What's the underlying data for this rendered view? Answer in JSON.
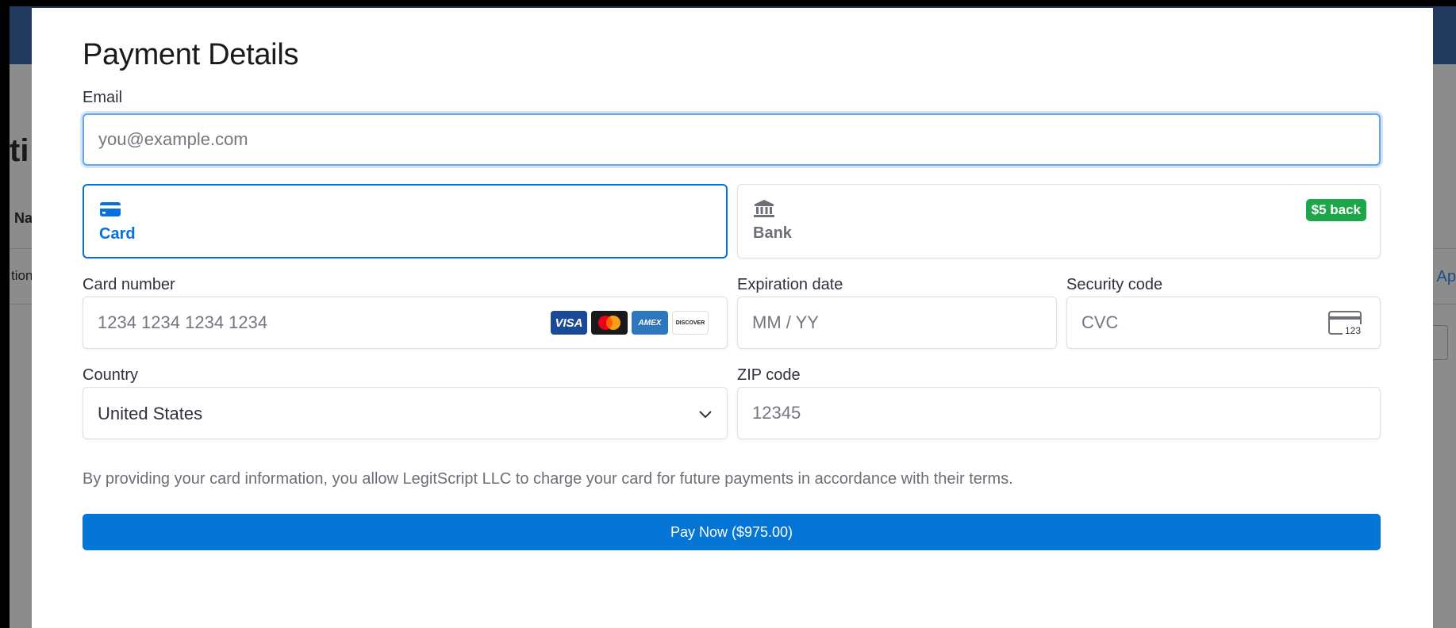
{
  "background_fragments": {
    "heading": "ti",
    "col_header": "Na",
    "row_text": "tion",
    "link": "e Ap"
  },
  "title": "Payment Details",
  "email": {
    "label": "Email",
    "placeholder": "you@example.com"
  },
  "tabs": {
    "card": {
      "label": "Card",
      "icon": "credit-card-icon",
      "selected": true
    },
    "bank": {
      "label": "Bank",
      "icon": "bank-icon",
      "badge": "$5 back"
    }
  },
  "card_number": {
    "label": "Card number",
    "placeholder": "1234 1234 1234 1234",
    "brands": [
      "VISA",
      "mastercard",
      "AMEX",
      "DISCOVER"
    ]
  },
  "expiration": {
    "label": "Expiration date",
    "placeholder": "MM / YY"
  },
  "security_code": {
    "label": "Security code",
    "placeholder": "CVC",
    "icon_text": "123"
  },
  "country": {
    "label": "Country",
    "value": "United States"
  },
  "zip": {
    "label": "ZIP code",
    "placeholder": "12345"
  },
  "notice": "By providing your card information, you allow LegitScript LLC to charge your card for future payments in accordance with their terms.",
  "pay_button": "Pay Now ($975.00)",
  "colors": {
    "accent": "#0570de",
    "pay_button": "#0576d6",
    "badge": "#1ea64a"
  }
}
